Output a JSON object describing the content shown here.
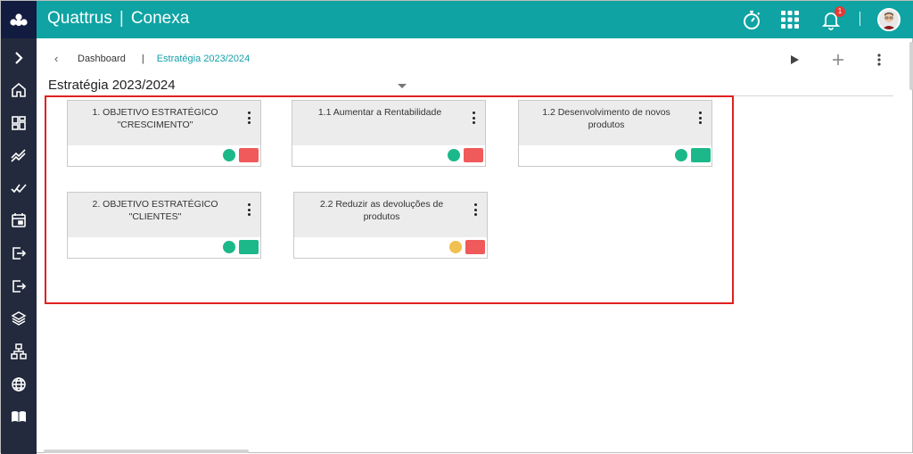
{
  "app": {
    "brand": "Quattrus",
    "product": "Conexa",
    "notifications_count": "1"
  },
  "colors": {
    "topbar": "#0fa3a3",
    "sidebar": "#232a3d",
    "logo_bg": "#121b40",
    "status_green": "#1cb88a",
    "status_red": "#f05a5a",
    "status_yellow": "#f0c050",
    "highlight_border": "#e02020"
  },
  "topbar_icons": [
    "stopwatch-icon",
    "apps-grid-icon",
    "bell-icon",
    "user-avatar"
  ],
  "sidebar": {
    "items": [
      {
        "name": "expand-icon"
      },
      {
        "name": "home-icon"
      },
      {
        "name": "dashboard-icon"
      },
      {
        "name": "trend-icon"
      },
      {
        "name": "double-check-icon"
      },
      {
        "name": "calendar-icon"
      },
      {
        "name": "export-icon"
      },
      {
        "name": "logout-icon"
      },
      {
        "name": "layers-icon"
      },
      {
        "name": "hierarchy-icon"
      },
      {
        "name": "globe-icon"
      },
      {
        "name": "book-icon"
      }
    ]
  },
  "breadcrumb": {
    "back": "‹",
    "root": "Dashboard",
    "separator": "|",
    "current": "Estratégia 2023/2024"
  },
  "header_actions": [
    "play-icon",
    "add-icon",
    "more-vertical-icon"
  ],
  "page": {
    "title": "Estratégia 2023/2024"
  },
  "cards": [
    {
      "title": "1. OBJETIVO ESTRATÉGICO \"CRESCIMENTO\"",
      "status": "green",
      "flag": "red"
    },
    {
      "title": "1.1 Aumentar a Rentabilidade",
      "status": "green",
      "flag": "red"
    },
    {
      "title": "1.2 Desenvolvimento de novos produtos",
      "status": "green",
      "flag": "green"
    },
    {
      "title": "2. OBJETIVO ESTRATÉGICO \"CLIENTES\"",
      "status": "green",
      "flag": "green"
    },
    {
      "title": "2.2 Reduzir as devoluções de produtos",
      "status": "yellow",
      "flag": "red"
    }
  ]
}
